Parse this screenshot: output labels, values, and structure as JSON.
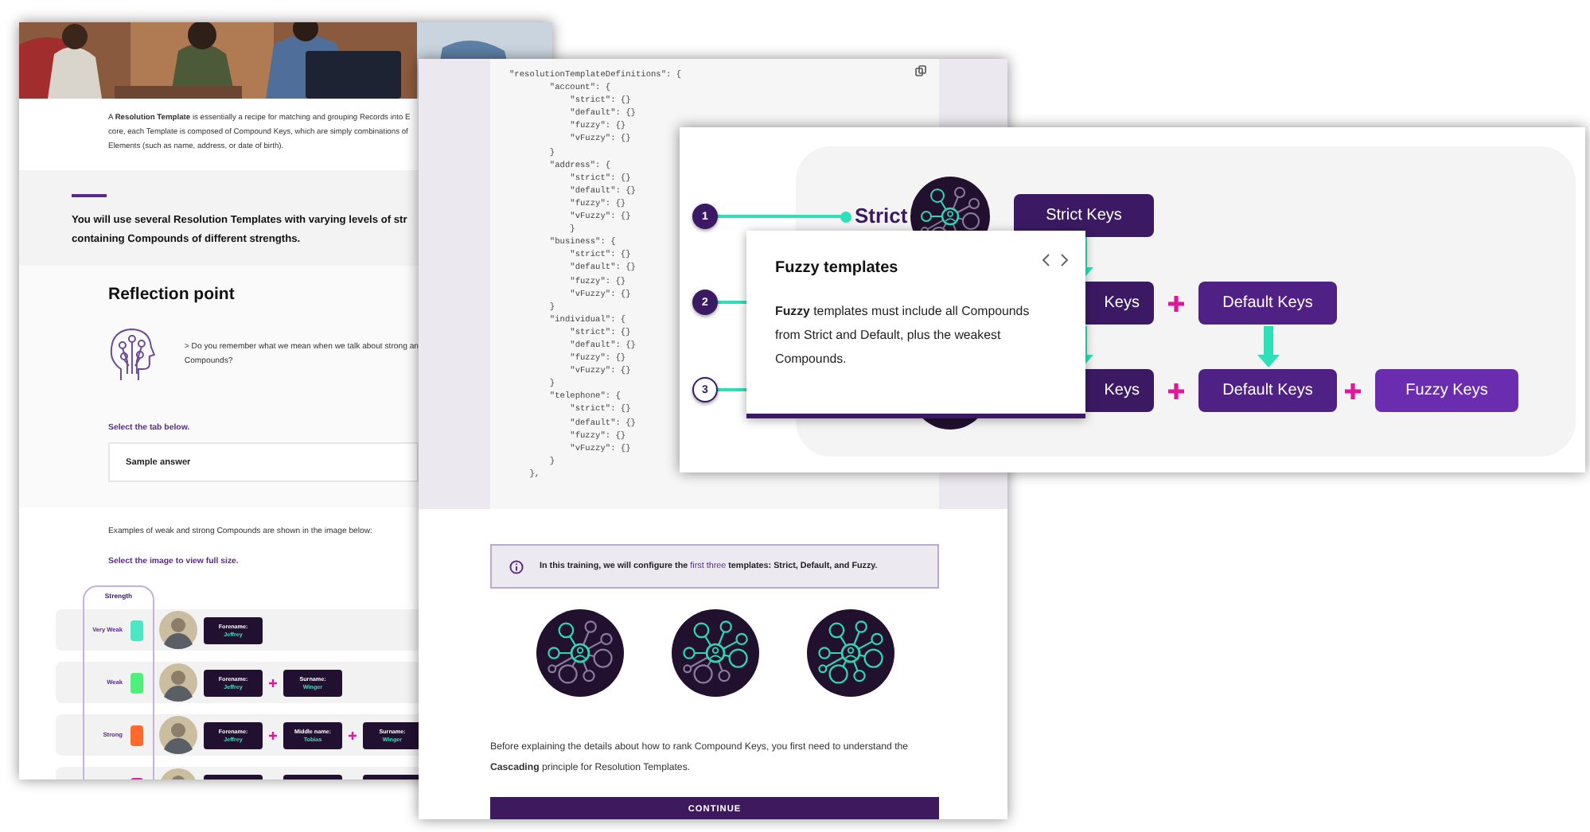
{
  "lesson_page": {
    "intro_lines": [
      "A **Resolution Template** is essentially a recipe for matching and grouping Records into E",
      "core, each Template is composed of Compound Keys, which are simply combinations of",
      "Elements (such as name, address, or date of birth)."
    ],
    "highlight_lines": [
      "You will use several Resolution Templates with varying levels of str",
      "containing Compounds of different strengths."
    ],
    "reflection": {
      "title": "Reflection point",
      "question_lines": [
        "> Do you remember what we mean when we talk about strong an",
        "Compounds?"
      ],
      "prompt": "Select the tab below.",
      "tab_label": "Sample answer"
    },
    "examples_text": "Examples of weak and strong Compounds are shown in the image below:",
    "image_prompt": "Select the image to view full size.",
    "strength_table": {
      "heading": "Strength",
      "rows": [
        {
          "label": "Very Weak",
          "color": "#4de6c4",
          "keys": [
            {
              "kind": "text",
              "name": "Forename:",
              "value": "Jeffrey"
            }
          ]
        },
        {
          "label": "Weak",
          "color": "#4ef07c",
          "keys": [
            {
              "kind": "text",
              "name": "Forename:",
              "value": "Jeffrey"
            },
            {
              "kind": "text",
              "name": "Surname:",
              "value": "Winger"
            }
          ]
        },
        {
          "label": "Strong",
          "color": "#ff6a2c",
          "keys": [
            {
              "kind": "text",
              "name": "Forename:",
              "value": "Jeffrey"
            },
            {
              "kind": "text",
              "name": "Middle name:",
              "value": "Tobias"
            },
            {
              "kind": "text",
              "name": "Surname:",
              "value": "Winger"
            }
          ]
        },
        {
          "color": "#e61ea0",
          "keys": [
            {
              "kind": "blank"
            },
            {
              "kind": "blank"
            },
            {
              "kind": "blank"
            }
          ]
        }
      ]
    }
  },
  "code_page": {
    "code_lines": [
      "\"resolutionTemplateDefinitions\": {",
      "        \"account\": {",
      "            \"strict\": {}",
      "            \"default\": {}",
      "            \"fuzzy\": {}",
      "            \"vFuzzy\": {}",
      "        }",
      "        \"address\": {",
      "            \"strict\": {}",
      "            \"default\": {}",
      "            \"fuzzy\": {}",
      "            \"vFuzzy\": {}",
      "            }",
      "        \"business\": {",
      "            \"strict\": {}",
      "            \"default\": {}",
      "            \"fuzzy\": {}",
      "            \"vFuzzy\": {}",
      "        }",
      "        \"individual\": {",
      "            \"strict\": {}",
      "            \"default\": {}",
      "            \"fuzzy\": {}",
      "            \"vFuzzy\": {}",
      "        }",
      "        \"telephone\": {",
      "            \"strict\": {}",
      "            \"default\": {}",
      "            \"fuzzy\": {}",
      "            \"vFuzzy\": {}",
      "        }",
      "    },"
    ],
    "info": {
      "before": "In this training, we will configure the",
      "link": "first three",
      "after": "templates: Strict, Default, and Fuzzy."
    },
    "template_icons": [
      {
        "kind": "strict"
      },
      {
        "kind": "default"
      },
      {
        "kind": "fuzzy"
      }
    ],
    "paragraph": "Before explaining the details about how to rank Compound Keys, you first need to understand the **Cascading** principle for Resolution Templates.",
    "button": "CONTINUE"
  },
  "diagram_page": {
    "templates": [
      {
        "number": "1",
        "selected": false,
        "label": "Strict",
        "kind": "strict",
        "keys": [
          {
            "label": "Strict Keys",
            "kind": "strict",
            "cut": false
          }
        ]
      },
      {
        "number": "2",
        "selected": false,
        "keys": [
          {
            "label": "Keys",
            "kind": "strict",
            "cut": true
          },
          {
            "label": "Default Keys",
            "kind": "default",
            "cut": false
          }
        ]
      },
      {
        "number": "3",
        "selected": true,
        "kind": "fuzzy",
        "keys": [
          {
            "label": "Keys",
            "kind": "strict",
            "cut": true
          },
          {
            "label": "Default Keys",
            "kind": "default",
            "cut": false
          },
          {
            "label": "Fuzzy Keys",
            "kind": "fuzzy",
            "cut": false
          }
        ]
      }
    ],
    "popup": {
      "title": "Fuzzy templates",
      "text": "**Fuzzy** templates must include all Compounds from Strict and Default, plus the weakest Compounds."
    }
  }
}
